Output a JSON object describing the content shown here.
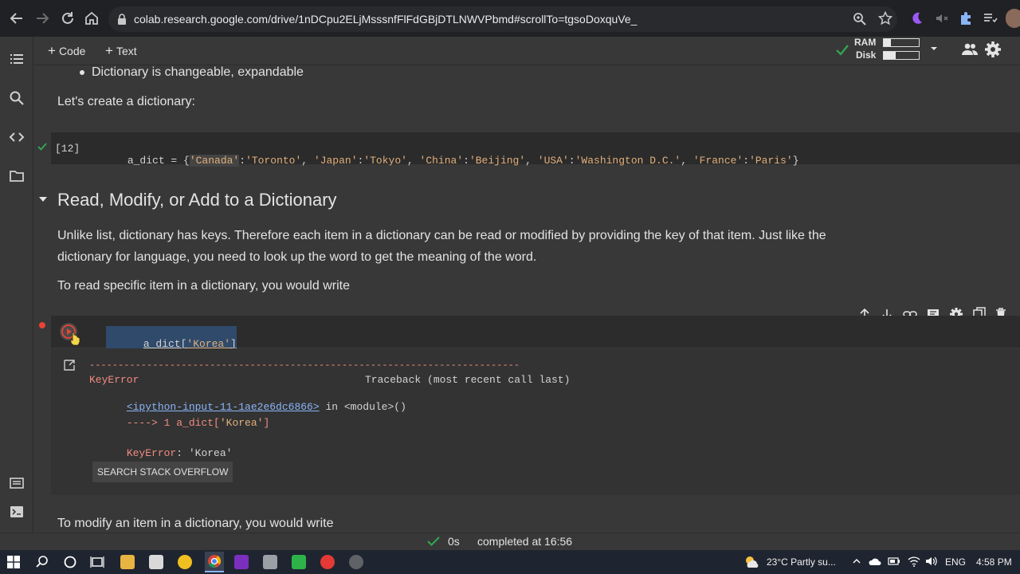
{
  "browser": {
    "url": "colab.research.google.com/drive/1nDCpu2ELjMsssnfFlFdGBjDTLNWVPbmd#scrollTo=tgsoDoxquVe_"
  },
  "toolbar": {
    "code_label": "Code",
    "text_label": "Text",
    "ram_label": "RAM",
    "disk_label": "Disk",
    "ram_usage": 0.2,
    "disk_usage": 0.35
  },
  "notebook": {
    "bullet_text": "Dictionary is changeable, expandable",
    "intro_text": "Let's create a dictionary:",
    "cell12": {
      "exec_count": "[12]",
      "code_prefix": "a_dict = {",
      "pairs": [
        {
          "k": "'Canada'",
          "v": "'Toronto'"
        },
        {
          "k": "'Japan'",
          "v": "'Tokyo'"
        },
        {
          "k": "'China'",
          "v": "'Beijing'"
        },
        {
          "k": "'USA'",
          "v": "'Washington D.C.'"
        },
        {
          "k": "'France'",
          "v": "'Paris'"
        }
      ],
      "code_suffix": "}"
    },
    "section_heading": "Read, Modify, or Add to a Dictionary",
    "para1_line1": "Unlike list, dictionary has keys. Therefore each item in a dictionary can be read or modified by providing the key of that item. Just like the",
    "para1_line2": "dictionary for language, you need to look up the word to get the meaning of the word.",
    "para2": "To read specific item in a dictionary, you would write",
    "cell11": {
      "code_name": "a_dict[",
      "code_key": "'Korea'",
      "code_close": "]",
      "output": {
        "dashes": "---------------------------------------------------------------------------",
        "error_name": "KeyError",
        "traceback_label": "Traceback (most recent call last)",
        "input_link": "<ipython-input-11-1ae2e6dc6866>",
        "in_module": " in <module>()",
        "arrow_line_prefix": "----> 1 a_dict[",
        "arrow_line_key": "'Korea'",
        "arrow_line_suffix": "]",
        "error_line_name": "KeyError",
        "error_line_msg": ": 'Korea'",
        "so_button": "SEARCH STACK OVERFLOW"
      }
    },
    "para3": "To modify an item in a dictionary, you would write"
  },
  "status": {
    "duration": "0s",
    "completed": "completed at 16:56"
  },
  "taskbar": {
    "weather": "23°C  Partly su...",
    "language": "ENG",
    "time": "4:58 PM"
  }
}
